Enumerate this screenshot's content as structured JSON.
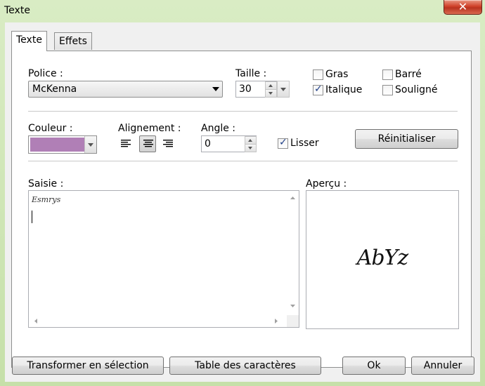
{
  "window": {
    "title": "Texte",
    "close_glyph": "✕"
  },
  "tabs": [
    {
      "label": "Texte",
      "active": true
    },
    {
      "label": "Effets",
      "active": false
    }
  ],
  "font": {
    "label": "Police :",
    "value": "McKenna"
  },
  "size": {
    "label": "Taille :",
    "value": "30"
  },
  "styles": {
    "bold": {
      "label": "Gras",
      "checked": false
    },
    "italic": {
      "label": "Italique",
      "checked": true
    },
    "strike": {
      "label": "Barré",
      "checked": false
    },
    "underline": {
      "label": "Souligné",
      "checked": false
    }
  },
  "color": {
    "label": "Couleur :",
    "value": "#b07fb6"
  },
  "alignment": {
    "label": "Alignement :",
    "options": [
      "left",
      "center",
      "right"
    ],
    "selected": "center"
  },
  "angle": {
    "label": "Angle :",
    "value": "0"
  },
  "smooth": {
    "label": "Lisser",
    "checked": true
  },
  "reset_label": "Réinitialiser",
  "input": {
    "label": "Saisie :",
    "text": "Esmrys"
  },
  "preview": {
    "label": "Aperçu :",
    "sample": "AbYz"
  },
  "footer": {
    "transform_label": "Transformer en sélection",
    "charmap_label": "Table des caractères",
    "ok_label": "Ok",
    "cancel_label": "Annuler"
  },
  "icons": {
    "check": "check-icon",
    "close": "close-icon"
  }
}
